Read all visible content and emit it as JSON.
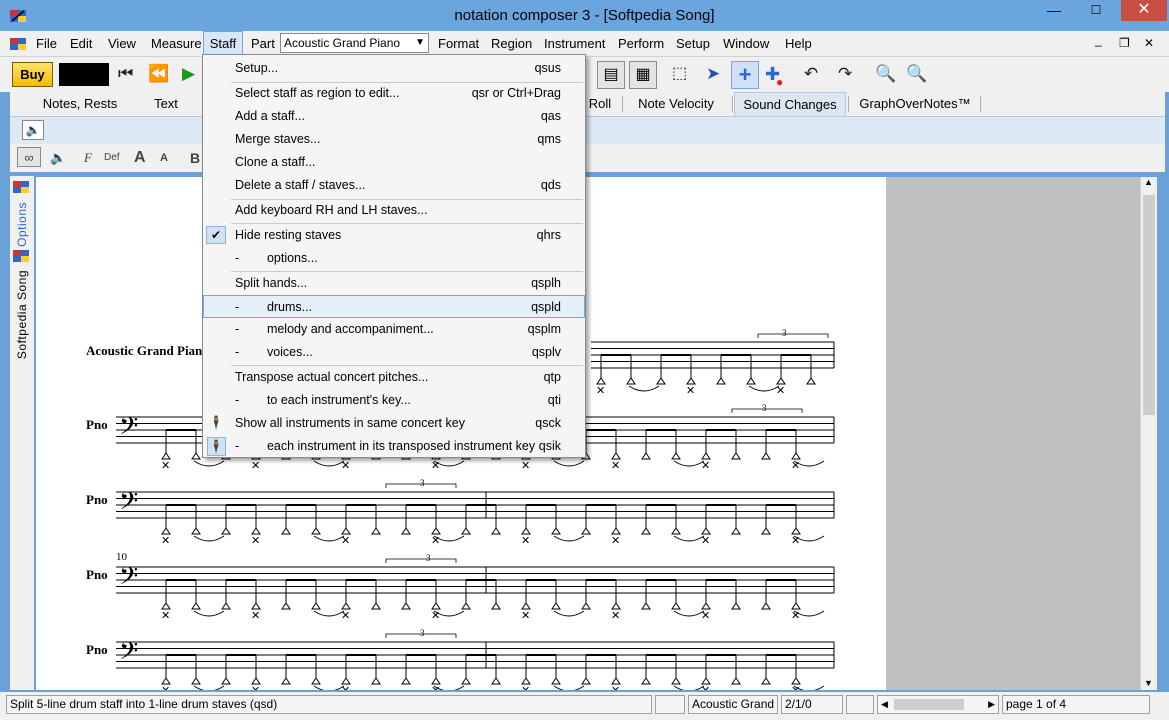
{
  "window": {
    "title": "notation composer 3 - [Softpedia Song]",
    "min_glyph": "—",
    "max_glyph": "☐",
    "close_glyph": "✕",
    "mdi_min": "_",
    "mdi_restore": "❐",
    "mdi_close": "✕"
  },
  "menubar": {
    "items": [
      "File",
      "Edit",
      "View",
      "Measure",
      "Staff",
      "Part",
      "Format",
      "Region",
      "Instrument",
      "Perform",
      "Setup",
      "Window",
      "Help"
    ],
    "active": "Staff",
    "part_select": "Acoustic Grand Piano"
  },
  "toolbar": {
    "buy_label": "Buy"
  },
  "tabs": {
    "items": [
      "Notes,  Rests",
      "Text",
      "Roll",
      "Note Velocity",
      "Sound Changes",
      "GraphOverNotes™"
    ],
    "selected": "Sound Changes"
  },
  "toolbar2": {
    "font_label": "F",
    "def_label": "Def",
    "big_a": "A",
    "small_a": "A",
    "bold": "B"
  },
  "sidebar": {
    "options_label": "Options",
    "song_label": "Softpedia Song"
  },
  "staff_menu": [
    {
      "label": "Setup...",
      "shortcut": "qsus"
    },
    {
      "label": "Select staff as region to edit...",
      "shortcut": "qsr or Ctrl+Drag"
    },
    {
      "label": "Add a staff...",
      "shortcut": "qas"
    },
    {
      "label": "Merge staves...",
      "shortcut": "qms"
    },
    {
      "label": "Clone a staff...",
      "shortcut": ""
    },
    {
      "label": "Delete a staff / staves...",
      "shortcut": "qds"
    },
    {
      "label": "Add keyboard RH and LH staves...",
      "shortcut": ""
    },
    {
      "label": "Hide resting staves",
      "shortcut": "qhrs",
      "checked": true
    },
    {
      "label": "-        options...",
      "shortcut": ""
    },
    {
      "label": "Split hands...",
      "shortcut": "qsplh"
    },
    {
      "label": "-        drums...",
      "shortcut": "qspld",
      "highlighted": true
    },
    {
      "label": "-        melody and accompaniment...",
      "shortcut": "qsplm"
    },
    {
      "label": "-        voices...",
      "shortcut": "qsplv"
    },
    {
      "label": "Transpose actual concert pitches...",
      "shortcut": "qtp"
    },
    {
      "label": "-        to each instrument's key...",
      "shortcut": "qti"
    },
    {
      "label": "Show all instruments in same concert key",
      "shortcut": "qsck"
    },
    {
      "label": "-        each instrument in its transposed instrument key",
      "shortcut": "qsik"
    }
  ],
  "score": {
    "staves": [
      {
        "name": "Acoustic Grand Piano",
        "tuplet": "3"
      },
      {
        "name": "Pno",
        "tuplet": "3"
      },
      {
        "name": "Pno",
        "tuplet": "3"
      },
      {
        "name": "Pno",
        "tuplet": "3",
        "measure_number": "10"
      },
      {
        "name": "Pno",
        "tuplet": "3"
      }
    ]
  },
  "status": {
    "message": "Split 5-line drum staff into 1-line drum staves (qsd)",
    "instrument": "Acoustic Grand",
    "position": "2/1/0",
    "page": "page 1 of 4"
  },
  "colors": {
    "frame": "#6aa2d8",
    "close": "#c74f43",
    "menu_highlight": "#e6eef9"
  }
}
